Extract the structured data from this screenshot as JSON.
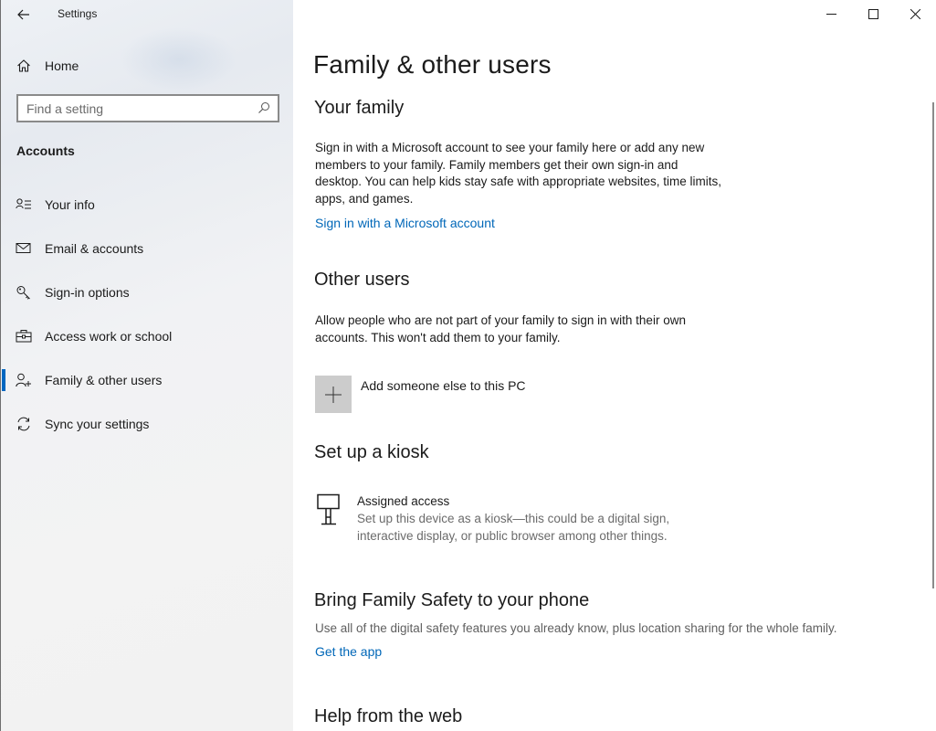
{
  "window": {
    "title": "Settings"
  },
  "sidebar": {
    "home_label": "Home",
    "search_placeholder": "Find a setting",
    "section_label": "Accounts",
    "items": [
      {
        "label": "Your info",
        "icon": "contact-info-icon"
      },
      {
        "label": "Email & accounts",
        "icon": "mail-icon"
      },
      {
        "label": "Sign-in options",
        "icon": "key-icon"
      },
      {
        "label": "Access work or school",
        "icon": "briefcase-icon"
      },
      {
        "label": "Family & other users",
        "icon": "person-add-icon",
        "active": true
      },
      {
        "label": "Sync your settings",
        "icon": "sync-icon"
      }
    ],
    "accent_color": "#0067c0"
  },
  "main": {
    "page_title": "Family & other users",
    "your_family": {
      "heading": "Your family",
      "description": "Sign in with a Microsoft account to see your family here or add any new members to your family. Family members get their own sign-in and desktop. You can help kids stay safe with appropriate websites, time limits, apps, and games.",
      "link": "Sign in with a Microsoft account"
    },
    "other_users": {
      "heading": "Other users",
      "description": "Allow people who are not part of your family to sign in with their own accounts. This won't add them to your family.",
      "add_label": "Add someone else to this PC"
    },
    "kiosk": {
      "heading": "Set up a kiosk",
      "title": "Assigned access",
      "description": "Set up this device as a kiosk—this could be a digital sign, interactive display, or public browser among other things."
    },
    "family_safety": {
      "heading": "Bring Family Safety to your phone",
      "description": "Use all of the digital safety features you already know, plus location sharing for the whole family.",
      "link": "Get the app"
    },
    "help": {
      "heading": "Help from the web"
    },
    "link_color": "#0067b8"
  }
}
